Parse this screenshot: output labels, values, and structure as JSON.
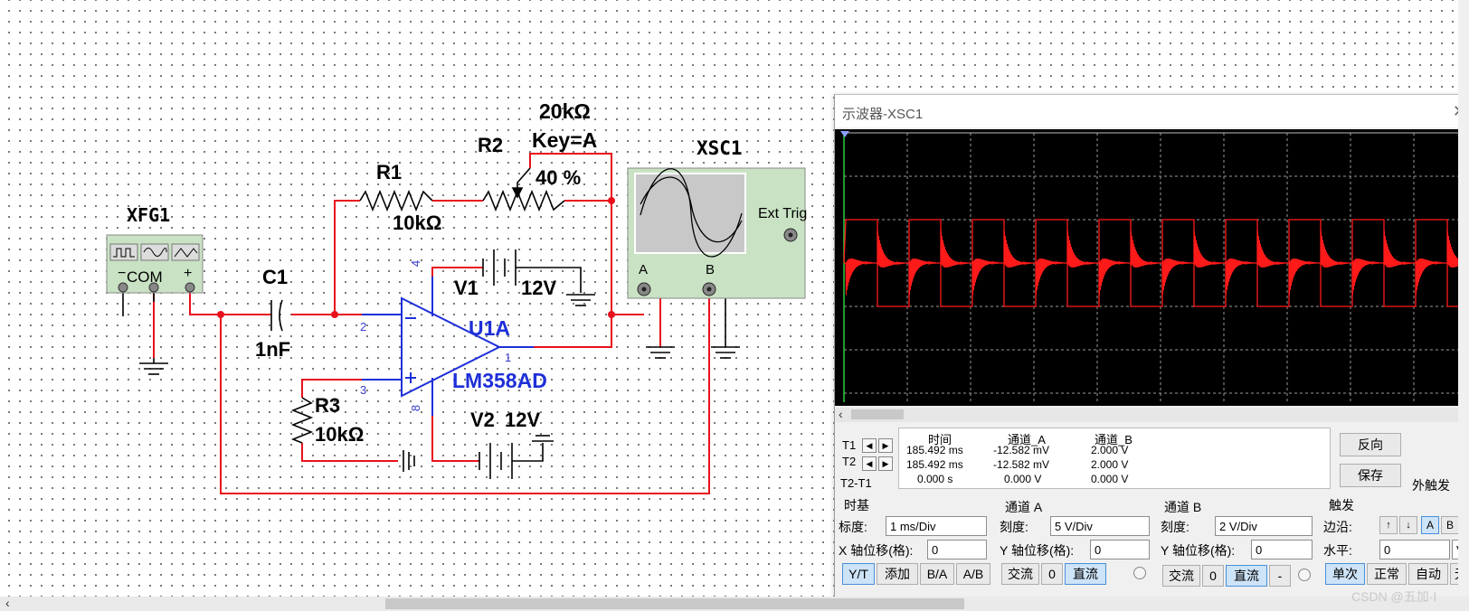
{
  "schematic": {
    "xfg": {
      "name": "XFG1",
      "com": "COM",
      "minus": "−",
      "plus": "+"
    },
    "c1": {
      "name": "C1",
      "value": "1nF"
    },
    "r1": {
      "name": "R1",
      "value": "10kΩ"
    },
    "r2": {
      "name": "R2",
      "value": "20kΩ",
      "key": "Key=A",
      "percent": "40 %"
    },
    "r3": {
      "name": "R3",
      "value": "10kΩ"
    },
    "u1": {
      "name": "U1A",
      "model": "LM358AD"
    },
    "v1": {
      "name": "V1",
      "value": "12V"
    },
    "v2": {
      "name": "V2",
      "value": "12V"
    },
    "xsc": {
      "name": "XSC1",
      "ext_trig": "Ext Trig",
      "a": "A",
      "b": "B"
    },
    "pins": {
      "p2": "2",
      "p3": "3",
      "p4": "4",
      "p8": "8",
      "p1": "1"
    },
    "wire_color": "#e8101c",
    "label_color": "#1e2fd8"
  },
  "oscilloscope": {
    "title": "示波器-XSC1",
    "trace_color": "#ff1a1a",
    "measurements": {
      "headers": [
        "时间",
        "通道_A",
        "通道_B"
      ],
      "rows": [
        {
          "label": "T1",
          "time": "185.492 ms",
          "a": "-12.582 mV",
          "b": "2.000 V"
        },
        {
          "label": "T2",
          "time": "185.492 ms",
          "a": "-12.582 mV",
          "b": "2.000 V"
        },
        {
          "label": "T2-T1",
          "time": "0.000 s",
          "a": "0.000 V",
          "b": "0.000 V"
        }
      ]
    },
    "buttons": {
      "reverse": "反向",
      "save": "保存"
    },
    "ext_trigger": "外触发",
    "timebase": {
      "title": "时基",
      "scale_label": "标度:",
      "scale": "1 ms/Div",
      "xpos_label": "X 轴位移(格):",
      "xpos": "0",
      "modes": [
        "Y/T",
        "添加",
        "B/A",
        "A/B"
      ]
    },
    "channel_a": {
      "title": "通道 A",
      "scale_label": "刻度:",
      "scale": "5  V/Div",
      "ypos_label": "Y 轴位移(格):",
      "ypos": "0",
      "coupling": [
        "交流",
        "0",
        "直流"
      ]
    },
    "channel_b": {
      "title": "通道 B",
      "scale_label": "刻度:",
      "scale": "2  V/Div",
      "ypos_label": "Y 轴位移(格):",
      "ypos": "0",
      "coupling": [
        "交流",
        "0",
        "直流",
        "-"
      ]
    },
    "trigger": {
      "title": "触发",
      "edge_label": "边沿:",
      "level_label": "水平:",
      "level": "0",
      "level_unit": "V",
      "sources": [
        "A",
        "B",
        "E"
      ],
      "modes": [
        "单次",
        "正常",
        "自动",
        "无"
      ]
    }
  },
  "watermark": "CSDN @五加·I"
}
